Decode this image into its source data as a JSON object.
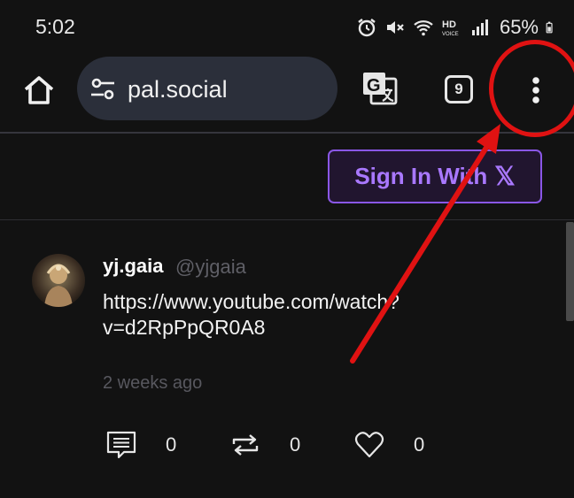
{
  "status_bar": {
    "time": "5:02",
    "icons": [
      "alarm-icon",
      "mute-icon",
      "wifi-icon",
      "hd-voice-icon",
      "signal-icon"
    ],
    "battery_percent": "65%"
  },
  "toolbar": {
    "url": "pal.social",
    "tab_count": "9",
    "icons": [
      "home-icon",
      "site-settings-icon",
      "translate-icon",
      "tabs-icon",
      "more-vert-icon"
    ]
  },
  "header": {
    "sign_in_label": "Sign In With",
    "sign_in_x": "𝕏",
    "accent_color": "#8a57e6"
  },
  "post": {
    "author_name": "yj.gaia",
    "author_handle": "@yjgaia",
    "body_line1": "https://www.youtube.com/watch?",
    "body_line2": "v=d2RpPpQR0A8",
    "timestamp": "2 weeks ago",
    "actions": [
      {
        "name": "reply",
        "icon": "comment-icon",
        "count": "0"
      },
      {
        "name": "repost",
        "icon": "repost-icon",
        "count": "0"
      },
      {
        "name": "like",
        "icon": "heart-icon",
        "count": "0"
      }
    ]
  },
  "annotation": {
    "color": "#e01212",
    "marks": [
      "circle-around-menu",
      "arrow-to-menu"
    ]
  }
}
